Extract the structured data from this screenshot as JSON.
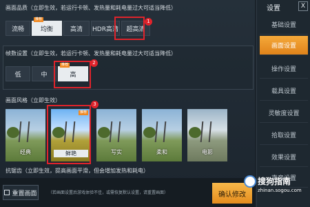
{
  "quality": {
    "title": "画面品质（立即生效，若运行卡顿、发热量和耗电量过大可适当降低）",
    "options": [
      {
        "label": "流畅",
        "selected": false,
        "tag": ""
      },
      {
        "label": "均衡",
        "selected": true,
        "tag": "推荐"
      },
      {
        "label": "高清",
        "selected": false,
        "tag": ""
      },
      {
        "label": "HDR高清",
        "selected": false,
        "tag": ""
      },
      {
        "label": "超高清",
        "selected": false,
        "tag": ""
      }
    ],
    "annotation": "1"
  },
  "framerate": {
    "title": "帧数设置（立即生效，若运行卡顿、发热量和耗电量过大可适当降低）",
    "options": [
      {
        "label": "低",
        "selected": false,
        "tag": ""
      },
      {
        "label": "中",
        "selected": false,
        "tag": ""
      },
      {
        "label": "高",
        "selected": true,
        "tag": "推荐"
      }
    ],
    "annotation": "2"
  },
  "style": {
    "title": "画面风格（立即生效）",
    "options": [
      {
        "label": "经典",
        "selected": false,
        "tag": ""
      },
      {
        "label": "鲜艳",
        "selected": true,
        "tag": "推荐"
      },
      {
        "label": "写实",
        "selected": false,
        "tag": ""
      },
      {
        "label": "柔和",
        "selected": false,
        "tag": ""
      },
      {
        "label": "电影",
        "selected": false,
        "tag": ""
      }
    ],
    "annotation": "3"
  },
  "antialias": {
    "title": "抗锯齿（立即生效，提高画面平滑，但会增加发热和耗电）"
  },
  "bottom": {
    "reset_label": "重置画面",
    "note": "（若画面设置后游戏体验不佳，或需恢复默认设置，请重置画面）",
    "confirm_label": "确认修改"
  },
  "sidebar": {
    "title": "设置",
    "close": "X",
    "items": [
      {
        "label": "基础设置",
        "active": false
      },
      {
        "label": "画面设置",
        "active": true
      },
      {
        "label": "操作设置",
        "active": false
      },
      {
        "label": "载具设置",
        "active": false
      },
      {
        "label": "灵敏度设置",
        "active": false
      },
      {
        "label": "拾取设置",
        "active": false
      },
      {
        "label": "效果设置",
        "active": false
      },
      {
        "label": "声音设置",
        "active": false
      }
    ]
  },
  "watermark": {
    "text": "搜狗指南",
    "url": "zhinan.sogou.com"
  },
  "colors": {
    "accent": "#e8922a",
    "annotation_red": "#e0232b"
  }
}
